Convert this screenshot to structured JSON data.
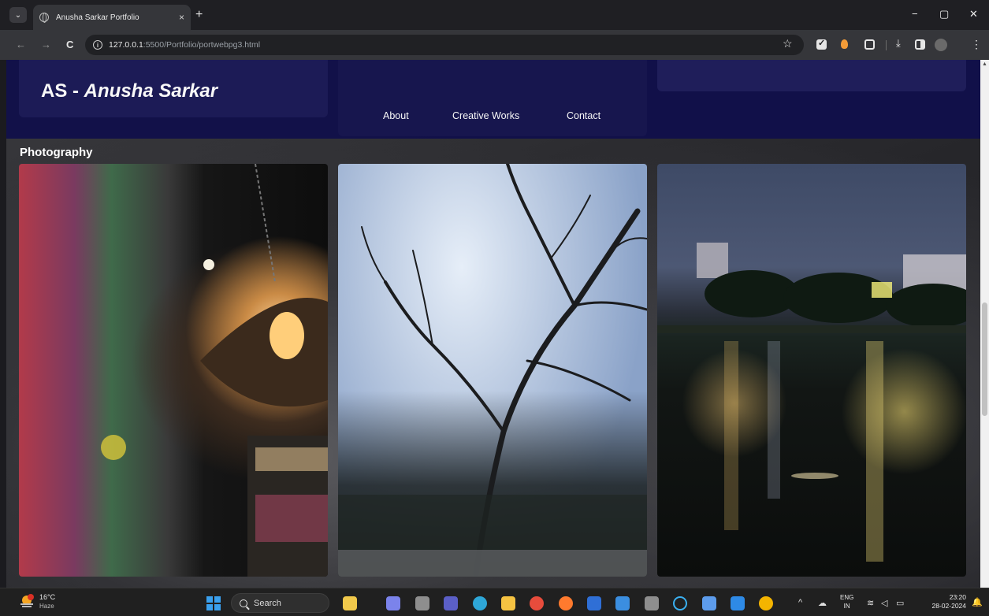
{
  "browser": {
    "tab": {
      "title": "Anusha Sarkar Portfolio",
      "close_glyph": "×"
    },
    "new_tab_glyph": "+",
    "window_controls": {
      "minimize": "−",
      "restore": "▢",
      "close": "✕"
    },
    "nav": {
      "back": "←",
      "forward": "→",
      "reload": "C"
    },
    "url": {
      "host": "127.0.0.1",
      "rest": ":5500/Portfolio/portwebpg3.html"
    },
    "bookmark_glyph": "☆",
    "menu_glyph": "⋮",
    "download_glyph": "⤓"
  },
  "page": {
    "brand": {
      "initials": "AS - ",
      "name": "Anusha Sarkar"
    },
    "nav": [
      {
        "label": "About"
      },
      {
        "label": "Creative Works"
      },
      {
        "label": "Contact"
      }
    ],
    "section_title": "Photography",
    "photos": [
      {
        "subject": "lamp and mural"
      },
      {
        "subject": "tree silhouette against clouds"
      },
      {
        "subject": "lake at night"
      }
    ]
  },
  "taskbar": {
    "weather": {
      "temp": "16°C",
      "desc": "Haze",
      "badge": "1"
    },
    "search_label": "Search",
    "tray_chevron": "^",
    "lang": {
      "line1": "ENG",
      "line2": "IN"
    },
    "clock": {
      "time": "23:20",
      "date": "28-02-2024"
    },
    "bell_glyph": "🔔",
    "apps": [
      {
        "icon": "files-icon",
        "color": "#f1c94b"
      },
      {
        "icon": "teams-icon",
        "color": "#7b83eb"
      },
      {
        "icon": "edge-icon",
        "color": "#2ea7d8"
      },
      {
        "icon": "explorer-icon",
        "color": "#f6c342"
      },
      {
        "icon": "chrome-icon",
        "color": "#e74c3c"
      },
      {
        "icon": "firefox-icon",
        "color": "#ff7a2e"
      },
      {
        "icon": "l-app-icon",
        "color": "#2f6fd6"
      },
      {
        "icon": "mail-icon",
        "color": "#3b8ee0"
      },
      {
        "icon": "calculator-icon",
        "color": "#8e8e8e"
      },
      {
        "icon": "cortana-icon",
        "color": "#3ab0f0"
      },
      {
        "icon": "tools-icon",
        "color": "#5d9cec"
      },
      {
        "icon": "vscode-icon",
        "color": "#2e8ae6"
      },
      {
        "icon": "chrome2-icon",
        "color": "#f4b400"
      }
    ]
  }
}
